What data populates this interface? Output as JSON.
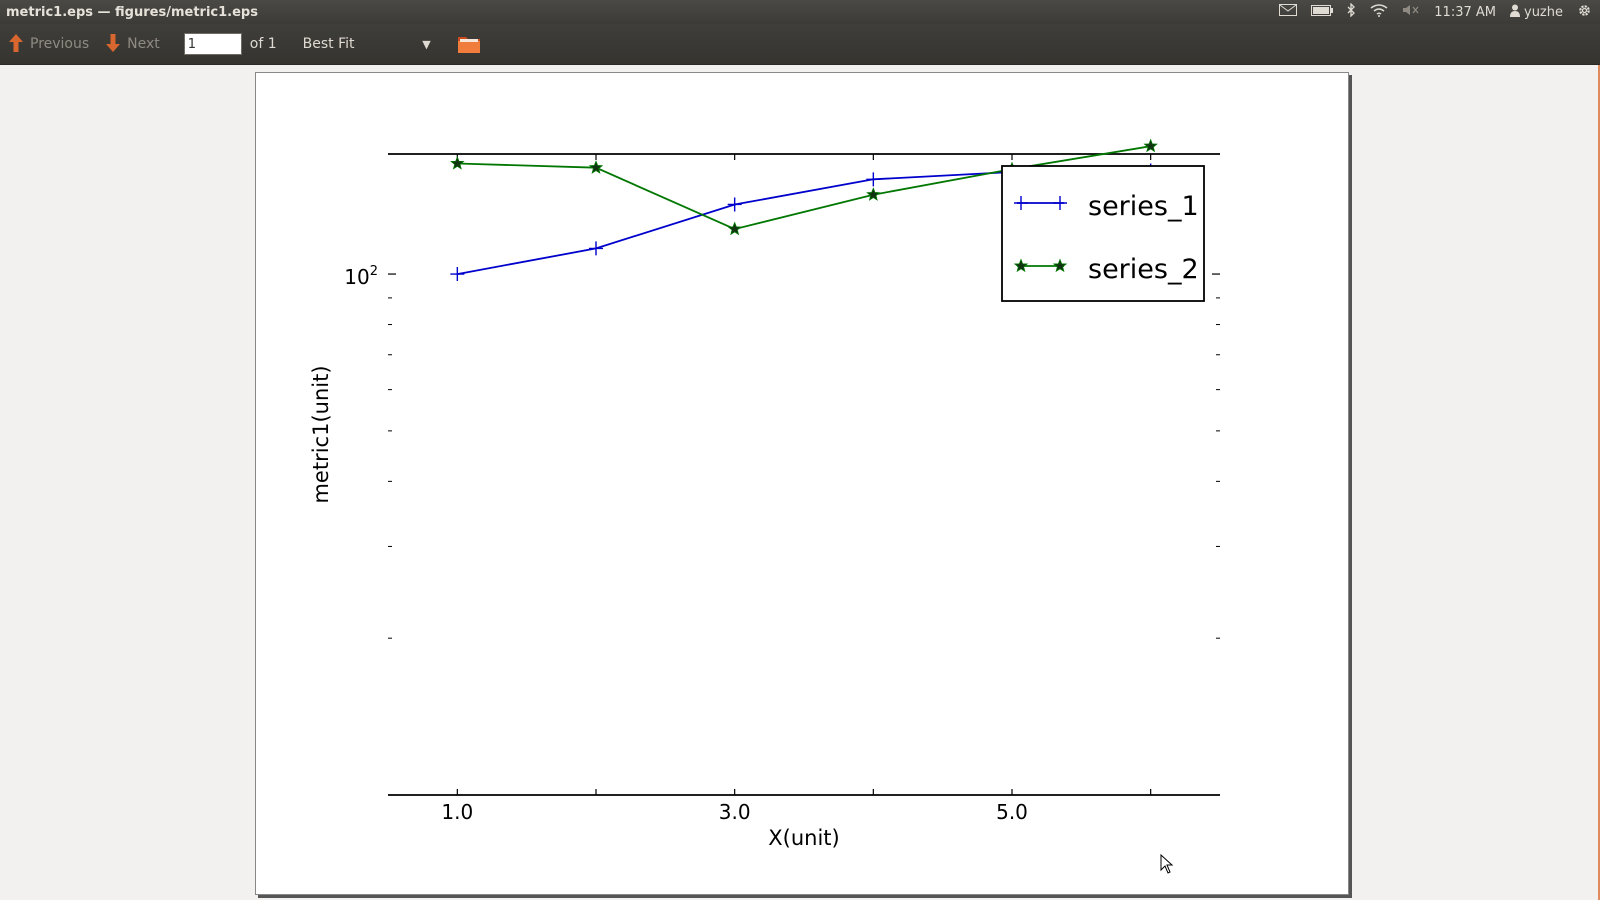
{
  "window": {
    "title": "metric1.eps — figures/metric1.eps"
  },
  "tray": {
    "time": "11:37 AM",
    "user": "yuzhe"
  },
  "toolbar": {
    "previous_label": "Previous",
    "next_label": "Next",
    "page_value": "1",
    "page_of": "of 1",
    "zoom_value": "Best Fit"
  },
  "chart_data": {
    "type": "line",
    "xlabel": "X(unit)",
    "ylabel": "metric1(unit)",
    "xlim": [
      0.5,
      6.5
    ],
    "ylim": [
      10,
      170
    ],
    "yscale": "log",
    "x_ticks": [
      1.0,
      3.0,
      5.0
    ],
    "x_tick_labels": [
      "1.0",
      "3.0",
      "5.0"
    ],
    "y_major_tick_label": "10",
    "y_major_tick_sup": "2",
    "grid": false,
    "legend": "top-right",
    "series": [
      {
        "name": "series_1",
        "color": "#0000cc",
        "marker": "plus",
        "x": [
          1,
          2,
          3,
          4,
          5,
          6
        ],
        "y": [
          100,
          112,
          136,
          152,
          157,
          158
        ]
      },
      {
        "name": "series_2",
        "color": "#007700",
        "marker": "star",
        "x": [
          1,
          2,
          3,
          4,
          5,
          6
        ],
        "y": [
          163,
          160,
          122,
          142,
          159,
          176
        ]
      }
    ]
  }
}
